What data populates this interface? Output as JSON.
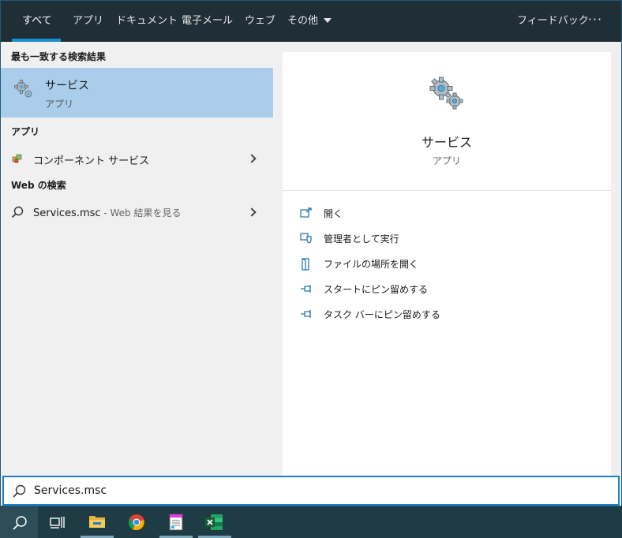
{
  "tabs": [
    {
      "label": "すべて",
      "active": true
    },
    {
      "label": "アプリ"
    },
    {
      "label": "ドキュメント"
    },
    {
      "label": "電子メール"
    },
    {
      "label": "ウェブ"
    },
    {
      "label": "その他"
    }
  ],
  "topbar": {
    "feedback": "フィードバック",
    "more": "···"
  },
  "best_match": {
    "header": "最も一致する検索結果",
    "title": "サービス",
    "subtitle": "アプリ",
    "icon": "gears-icon"
  },
  "apps": {
    "header": "アプリ",
    "items": [
      {
        "label": "コンポーネント サービス",
        "icon": "component-services-icon"
      }
    ]
  },
  "web": {
    "header": "Web の検索",
    "query": "Services.msc",
    "suffix": " - Web 結果を見る"
  },
  "detail": {
    "title": "サービス",
    "subtitle": "アプリ",
    "actions": [
      {
        "label": "開く",
        "icon": "open-icon"
      },
      {
        "label": "管理者として実行",
        "icon": "run-as-admin-icon"
      },
      {
        "label": "ファイルの場所を開く",
        "icon": "open-file-location-icon"
      },
      {
        "label": "スタートにピン留めする",
        "icon": "pin-start-icon"
      },
      {
        "label": "タスク バーにピン留めする",
        "icon": "pin-taskbar-icon"
      }
    ]
  },
  "search": {
    "value": "Services.msc"
  },
  "colors": {
    "accent": "#1a8fd6",
    "highlight": "#a9cdea",
    "topbar": "#1f2f35",
    "taskbar": "#1f3b44"
  }
}
